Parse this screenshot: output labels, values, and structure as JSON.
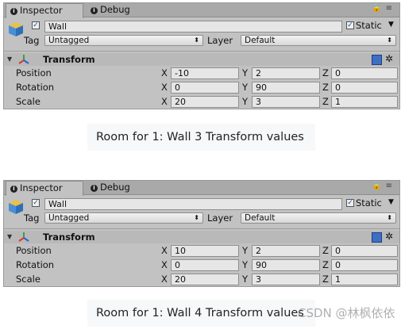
{
  "panels": [
    {
      "tabs": [
        {
          "label": "Inspector",
          "icon": "info-icon"
        },
        {
          "label": "Debug",
          "icon": "info-icon"
        }
      ],
      "object_name": "Wall",
      "static_label": "Static",
      "tag_label": "Tag",
      "tag_value": "Untagged",
      "layer_label": "Layer",
      "layer_value": "Default",
      "component_title": "Transform",
      "rows": [
        {
          "label": "Position",
          "x": "-10",
          "y": "2",
          "z": "0"
        },
        {
          "label": "Rotation",
          "x": "0",
          "y": "90",
          "z": "0"
        },
        {
          "label": "Scale",
          "x": "20",
          "y": "3",
          "z": "1"
        }
      ],
      "caption": "Room for 1: Wall 3 Transform values"
    },
    {
      "tabs": [
        {
          "label": "Inspector",
          "icon": "info-icon"
        },
        {
          "label": "Debug",
          "icon": "info-icon"
        }
      ],
      "object_name": "Wall",
      "static_label": "Static",
      "tag_label": "Tag",
      "tag_value": "Untagged",
      "layer_label": "Layer",
      "layer_value": "Default",
      "component_title": "Transform",
      "rows": [
        {
          "label": "Position",
          "x": "10",
          "y": "2",
          "z": "0"
        },
        {
          "label": "Rotation",
          "x": "0",
          "y": "90",
          "z": "0"
        },
        {
          "label": "Scale",
          "x": "20",
          "y": "3",
          "z": "1"
        }
      ],
      "caption": "Room for 1: Wall 4 Transform values"
    }
  ],
  "axis_labels": {
    "x": "X",
    "y": "Y",
    "z": "Z"
  },
  "watermark": "CSDN @林枫依依",
  "colors": {
    "panel": "#c2c2c2",
    "field": "#e6e6e6",
    "caption_bg": "#f7f8fa"
  }
}
